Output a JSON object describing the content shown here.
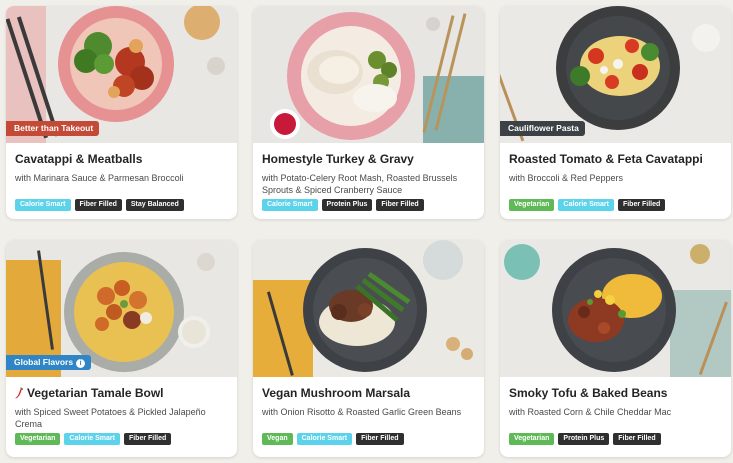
{
  "colors": {
    "calorie_smart": "#5cd3eb",
    "dark_tag": "#2f2f2f",
    "green_tag": "#5fb957",
    "ribbon_red": "#c24a37",
    "ribbon_dark": "#3c4146",
    "ribbon_blue": "#2f85c5"
  },
  "recipes": [
    {
      "title": "Cavatappi & Meatballs",
      "subtitle": "with Marinara Sauce & Parmesan Broccoli",
      "ribbon": "Better than Takeout",
      "tags": [
        "Calorie Smart",
        "Fiber Filled",
        "Stay Balanced"
      ]
    },
    {
      "title": "Homestyle Turkey & Gravy",
      "subtitle": "with Potato-Celery Root Mash, Roasted Brussels Sprouts & Spiced Cranberry Sauce",
      "tags": [
        "Calorie Smart",
        "Protein Plus",
        "Fiber Filled"
      ]
    },
    {
      "title": "Roasted Tomato & Feta Cavatappi",
      "subtitle": "with Broccoli & Red Peppers",
      "ribbon": "Cauliflower Pasta",
      "tags": [
        "Vegetarian",
        "Calorie Smart",
        "Fiber Filled"
      ]
    },
    {
      "title": "Vegetarian Tamale Bowl",
      "subtitle": "with Spiced Sweet Potatoes & Pickled Jalapeño Crema",
      "ribbon": "Global Flavors",
      "ribbon_info": "i",
      "tags": [
        "Vegetarian",
        "Calorie Smart",
        "Fiber Filled"
      ]
    },
    {
      "title": "Vegan Mushroom Marsala",
      "subtitle": "with Onion Risotto & Roasted Garlic Green Beans",
      "tags": [
        "Vegan",
        "Calorie Smart",
        "Fiber Filled"
      ]
    },
    {
      "title": "Smoky Tofu & Baked Beans",
      "subtitle": "with Roasted Corn & Chile Cheddar Mac",
      "tags": [
        "Vegetarian",
        "Protein Plus",
        "Fiber Filled"
      ]
    }
  ]
}
